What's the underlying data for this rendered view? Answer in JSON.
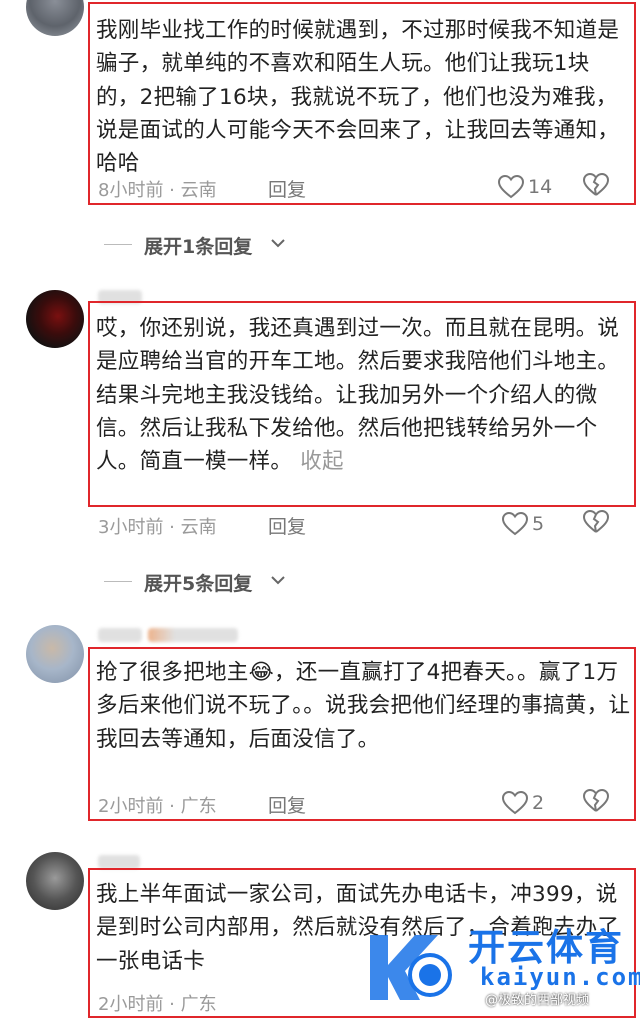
{
  "comments": [
    {
      "text": "我刚毕业找工作的时候就遇到，不过那时候我不知道是骗子，就单纯的不喜欢和陌生人玩。他们让我玩1块的，2把输了16块，我就说不玩了，他们也没为难我，说是面试的人可能今天不会回来了，让我回去等通知，哈哈",
      "time": "8小时前 · 云南",
      "reply": "回复",
      "likes": "14"
    },
    {
      "text": "哎，你还别说，我还真遇到过一次。而且就在昆明。说是应聘给当官的开车工地。然后要求我陪他们斗地主。结果斗完地主我没钱给。让我加另外一个介绍人的微信。然后让我私下发给他。然后他把钱转给另外一个人。简直一模一样。",
      "fold": "收起",
      "time": "3小时前 · 云南",
      "reply": "回复",
      "likes": "5"
    },
    {
      "text_pre": "抢了很多把地主",
      "emoji": "😂",
      "text_post": "，还一直赢打了4把春天。。赢了1万多后来他们说不玩了。。说我会把他们经理的事搞黄，让我回去等通知，后面没信了。",
      "time": "2小时前 · 广东",
      "reply": "回复",
      "likes": "2"
    },
    {
      "text": "我上半年面试一家公司，面试先办电话卡，冲399，说是到时公司内部用，然后就没有然后了，合着跑去办了一张电话卡",
      "time": "2小时前 · 广东"
    }
  ],
  "expanders": [
    {
      "label": "展开1条回复"
    },
    {
      "label": "展开5条回复"
    }
  ],
  "watermark": {
    "brand": "开云体育",
    "url": "kaiyun.com",
    "handle": "@极致的西部视频",
    "colors": {
      "red": "#e0262b",
      "blue": "#1a73e8"
    }
  },
  "icons": {
    "like": "heart-outline-icon",
    "dislike": "broken-heart-icon",
    "chevron": "chevron-down-icon"
  }
}
